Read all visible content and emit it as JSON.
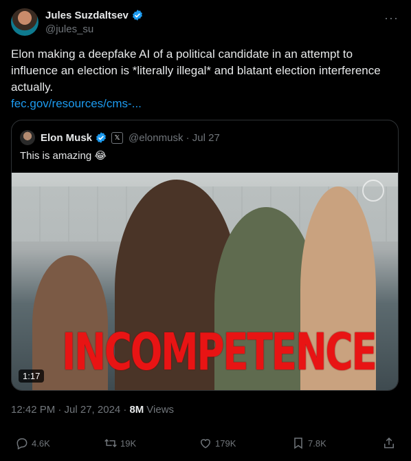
{
  "author": {
    "display_name": "Jules Suzdaltsev",
    "handle": "@jules_su"
  },
  "more_label": "···",
  "tweet": {
    "text": "Elon making a deepfake AI of a political candidate in an attempt to influence an election is *literally illegal* and blatant election interference actually.",
    "link": "fec.gov/resources/cms-..."
  },
  "quote": {
    "display_name": "Elon Musk",
    "x_badge": "𝕏",
    "handle_date": "@elonmusk · Jul 27",
    "text": "This is amazing 😂",
    "media": {
      "overlay_text": "INCOMPETENCE",
      "duration": "1:17"
    }
  },
  "meta": {
    "time": "12:42 PM · Jul 27, 2024 ·",
    "views": "8M",
    "views_label": "Views"
  },
  "actions": {
    "replies": "4.6K",
    "reposts": "19K",
    "likes": "179K",
    "bookmarks": "7.8K"
  },
  "colors": {
    "accent": "#1d9bf0",
    "overlay_red": "#e81414"
  }
}
